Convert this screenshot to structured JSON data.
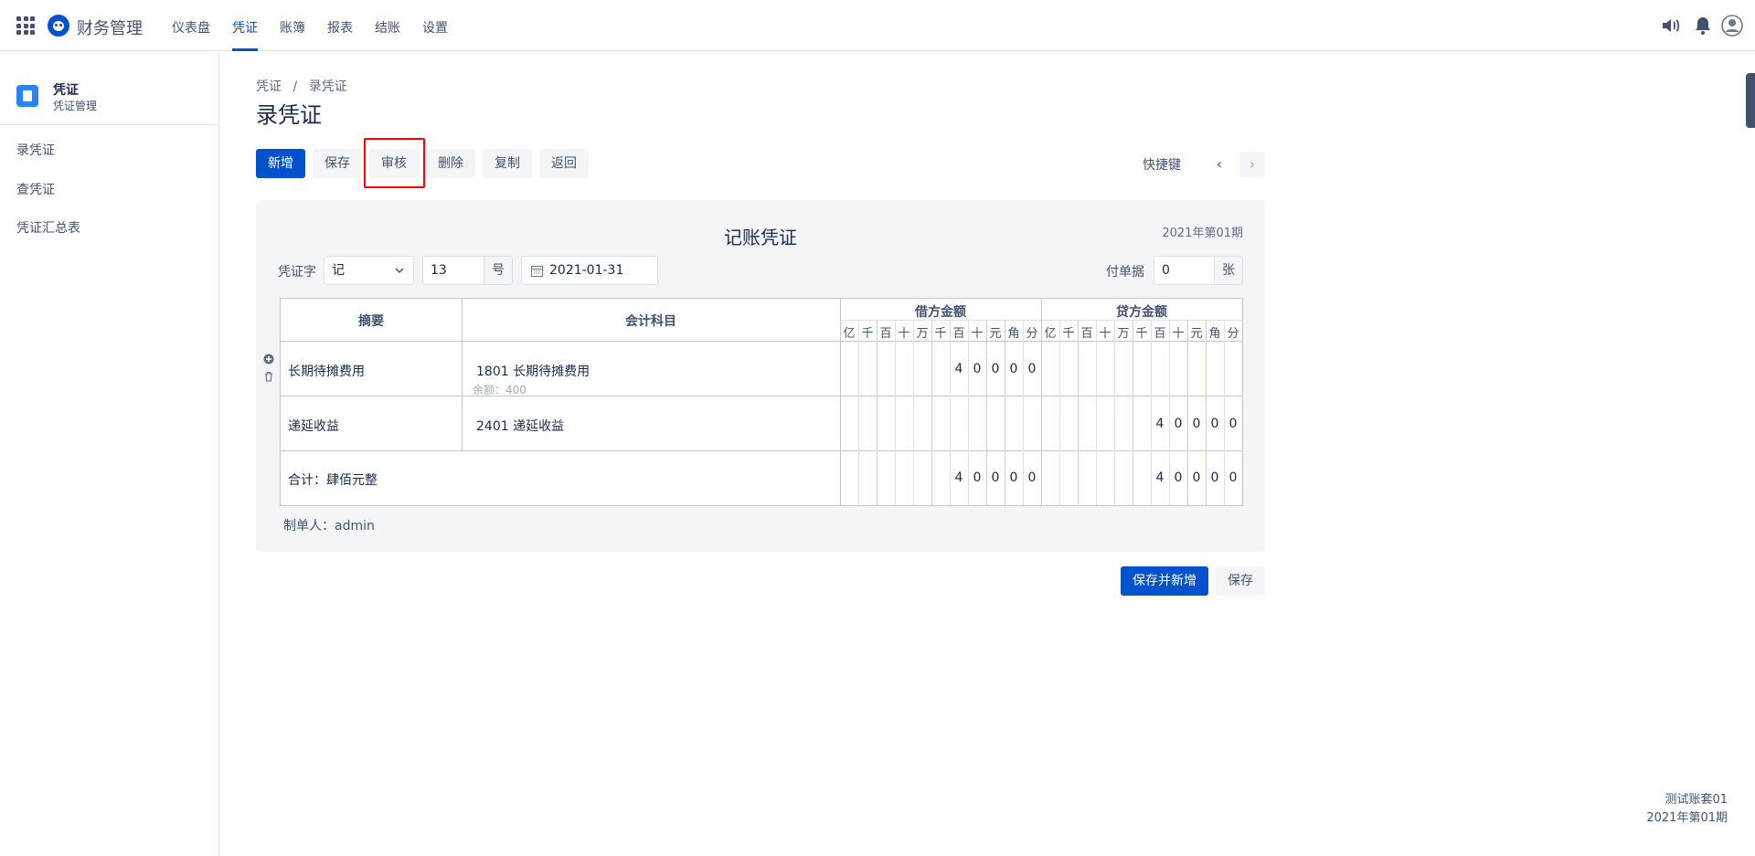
{
  "app": {
    "name": "财务管理"
  },
  "nav": {
    "items": [
      "仪表盘",
      "凭证",
      "账簿",
      "报表",
      "结账",
      "设置"
    ],
    "active": "凭证"
  },
  "sidebar": {
    "title": "凭证",
    "subtitle": "凭证管理",
    "items": [
      "录凭证",
      "查凭证",
      "凭证汇总表"
    ]
  },
  "breadcrumb": {
    "root": "凭证",
    "sep": "/",
    "current": "录凭证"
  },
  "page": {
    "title": "录凭证"
  },
  "toolbar": {
    "new": "新增",
    "save": "保存",
    "audit": "审核",
    "delete": "删除",
    "copy": "复制",
    "back": "返回",
    "shortcut": "快捷键",
    "prev_icon": "‹",
    "next_icon": "›"
  },
  "voucher": {
    "title": "记账凭证",
    "period": "2021年第01期",
    "word_label": "凭证字",
    "word_value": "记",
    "number_value": "13",
    "number_suffix": "号",
    "date_value": "2021-01-31",
    "attach_label": "付单据",
    "attach_value": "0",
    "attach_suffix": "张",
    "headers": {
      "summary": "摘要",
      "account": "会计科目",
      "debit": "借方金额",
      "credit": "贷方金额",
      "units": [
        "亿",
        "千",
        "百",
        "十",
        "万",
        "千",
        "百",
        "十",
        "元",
        "角",
        "分"
      ]
    },
    "rows": [
      {
        "summary": "长期待摊费用",
        "account": "1801 长期待摊费用",
        "balance": "余额：400",
        "debit": "40000",
        "credit": ""
      },
      {
        "summary": "递延收益",
        "account": "2401 递延收益",
        "balance": "",
        "debit": "",
        "credit": "40000"
      }
    ],
    "total": {
      "label": "合计：肆佰元整",
      "debit": "40000",
      "credit": "40000"
    },
    "maker": "制单人：admin"
  },
  "actions": {
    "save_and_new": "保存并新增",
    "save": "保存"
  },
  "footer": {
    "book": "测试账套01",
    "period": "2021年第01期"
  },
  "colors": {
    "primary": "#0052cc",
    "highlight": "#ff0000"
  }
}
